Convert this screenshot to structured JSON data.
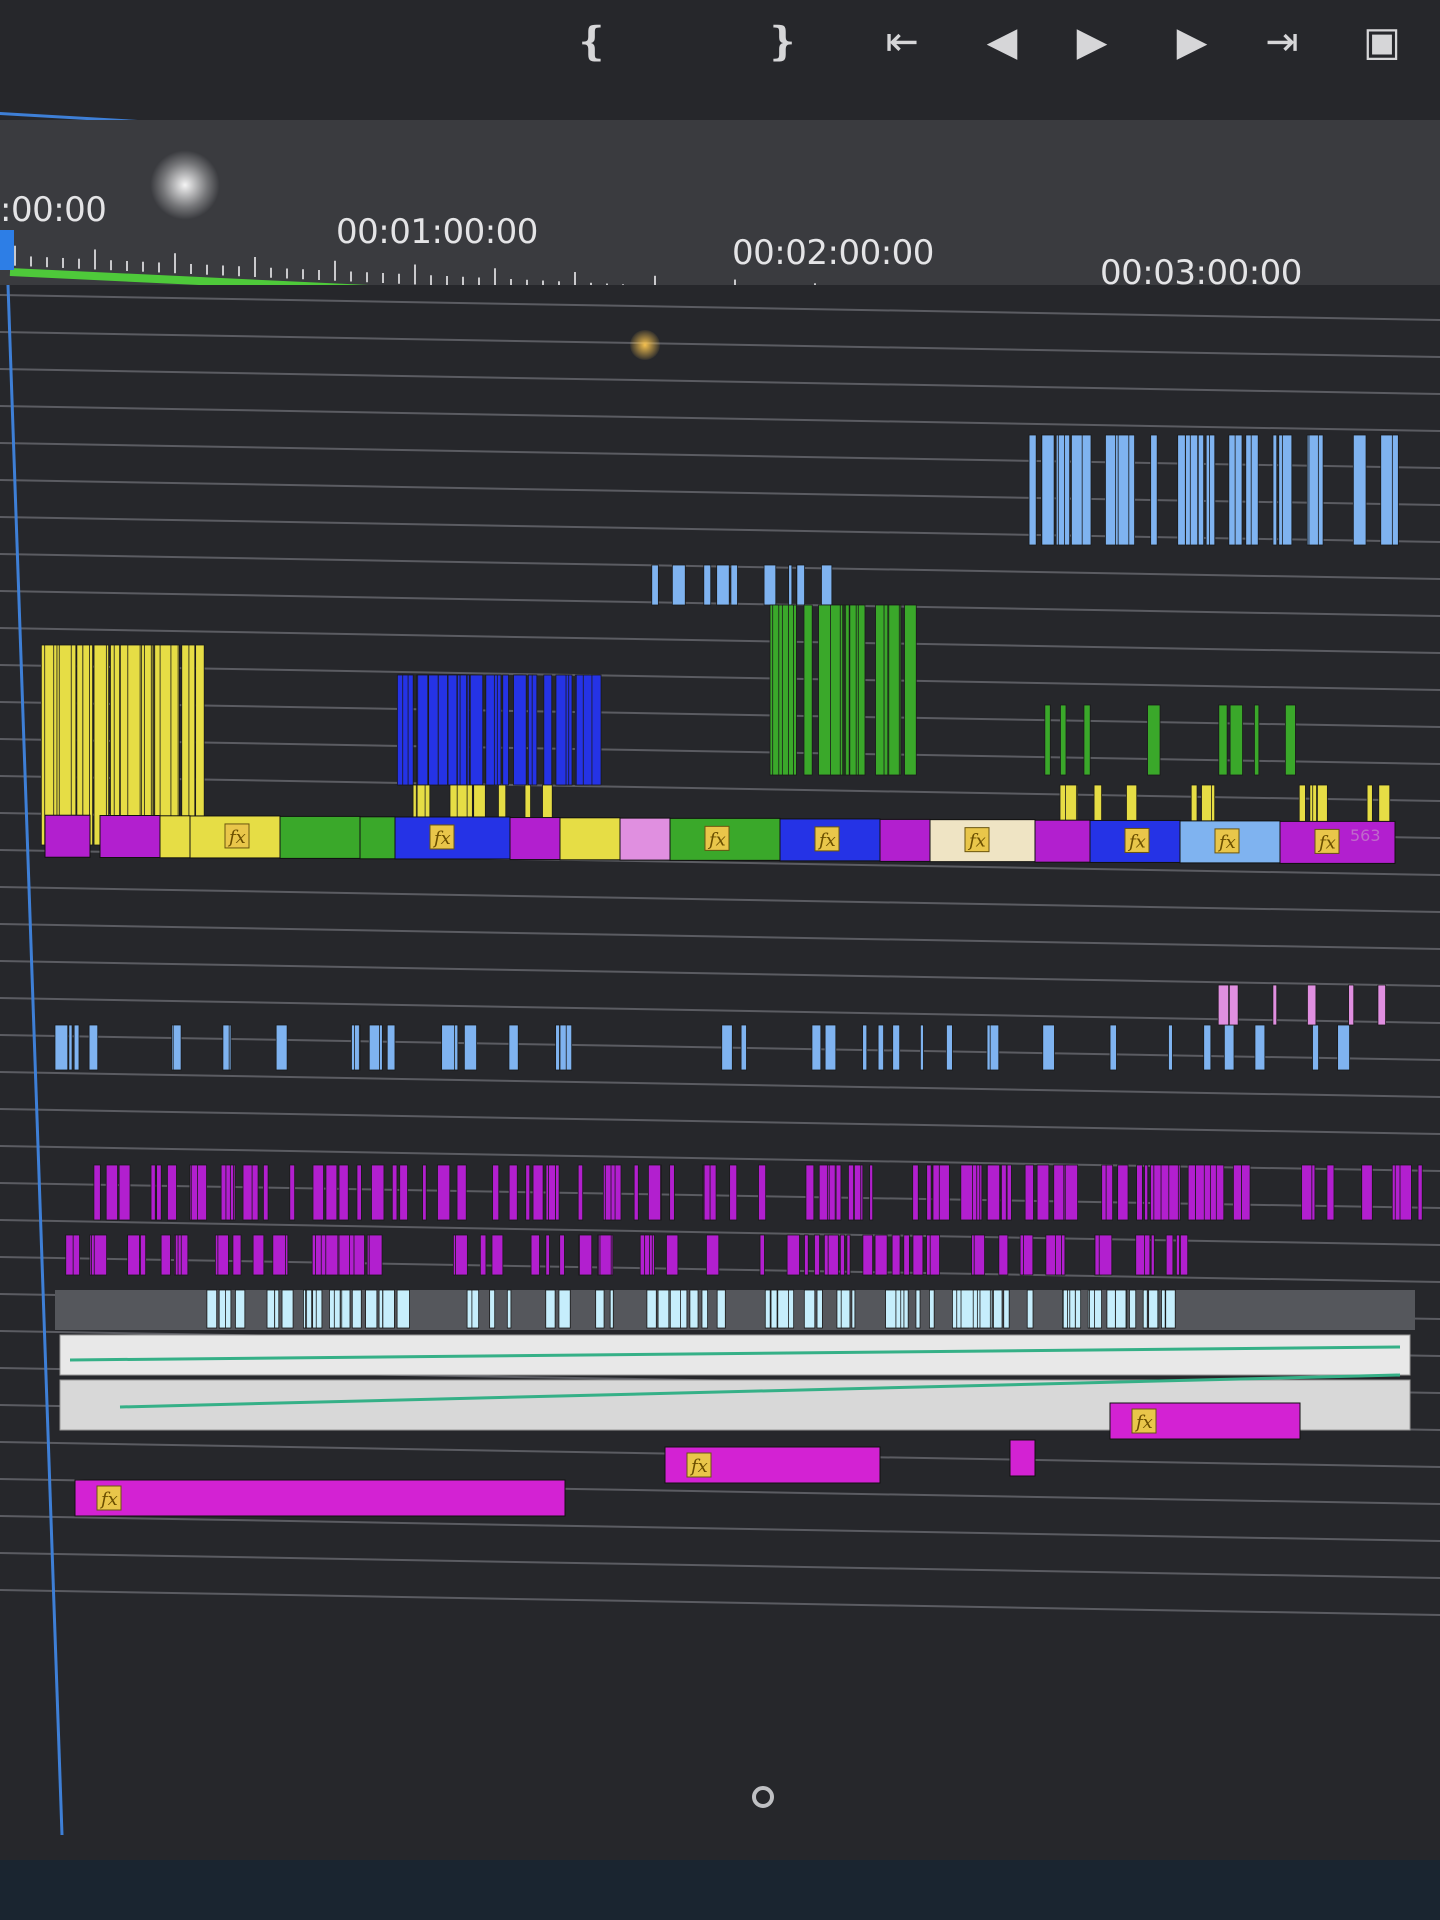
{
  "transport": {
    "buttons": [
      {
        "name": "mark-in-button",
        "glyph": "❴",
        "icon": "mark-in-icon"
      },
      {
        "name": "mark-out-button",
        "glyph": "❵",
        "icon": "mark-out-icon"
      },
      {
        "name": "go-to-in-button",
        "glyph": "⇤",
        "icon": "go-to-in-icon"
      },
      {
        "name": "step-back-button",
        "glyph": "◀",
        "icon": "step-back-icon"
      },
      {
        "name": "play-button",
        "glyph": "▶",
        "icon": "play-icon"
      },
      {
        "name": "step-forward-button",
        "glyph": "▶",
        "icon": "step-forward-icon"
      },
      {
        "name": "go-to-out-button",
        "glyph": "⇥",
        "icon": "go-to-out-icon"
      },
      {
        "name": "export-frame-button",
        "glyph": "▣",
        "icon": "camera-icon"
      }
    ]
  },
  "ruler": {
    "timecodes": [
      ":00:00",
      "00:01:00:00",
      "00:02:00:00",
      "00:03:00:00"
    ]
  },
  "timeline": {
    "fx_label": "fx",
    "clip_count_label": "563",
    "colors": {
      "background": "#26272b",
      "track_line": "#5b5c62",
      "playhead_bar": "#4ec93a",
      "yellow": "#e6dd45",
      "blue": "#2533e6",
      "green": "#3aa82a",
      "magenta": "#b21fcf",
      "pink": "#e08fe0",
      "light_blue": "#7fb3f0",
      "cream": "#efe4c4",
      "audio_gray": "#d8d8d8"
    }
  }
}
